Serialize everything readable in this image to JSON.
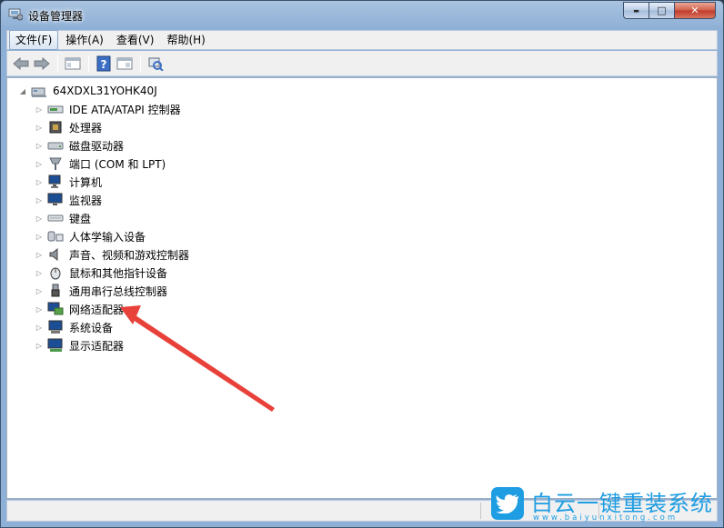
{
  "window": {
    "title": "设备管理器",
    "controls": {
      "minimize": "▬",
      "maximize": "□",
      "close": "✕"
    }
  },
  "menu": {
    "items": [
      {
        "label": "文件(F)"
      },
      {
        "label": "操作(A)"
      },
      {
        "label": "查看(V)"
      },
      {
        "label": "帮助(H)"
      }
    ]
  },
  "toolbar": {
    "buttons": [
      "back-icon",
      "forward-icon",
      "show-hide-console-tree-icon",
      "help-icon",
      "properties-icon",
      "scan-hardware-icon"
    ]
  },
  "tree": {
    "root": {
      "label": "64XDXL31YOHK40J",
      "icon": "computer-icon"
    },
    "items": [
      {
        "label": "IDE ATA/ATAPI 控制器",
        "icon": "ide-controller-icon"
      },
      {
        "label": "处理器",
        "icon": "processor-icon"
      },
      {
        "label": "磁盘驱动器",
        "icon": "disk-drive-icon"
      },
      {
        "label": "端口 (COM 和 LPT)",
        "icon": "port-icon"
      },
      {
        "label": "计算机",
        "icon": "computer-icon"
      },
      {
        "label": "监视器",
        "icon": "monitor-icon"
      },
      {
        "label": "键盘",
        "icon": "keyboard-icon"
      },
      {
        "label": "人体学输入设备",
        "icon": "hid-icon"
      },
      {
        "label": "声音、视频和游戏控制器",
        "icon": "speaker-icon"
      },
      {
        "label": "鼠标和其他指针设备",
        "icon": "mouse-icon"
      },
      {
        "label": "通用串行总线控制器",
        "icon": "usb-icon"
      },
      {
        "label": "网络适配器",
        "icon": "network-adapter-icon"
      },
      {
        "label": "系统设备",
        "icon": "system-device-icon"
      },
      {
        "label": "显示适配器",
        "icon": "display-adapter-icon"
      }
    ]
  },
  "annotation": {
    "color": "#e8413a",
    "points_to": "网络适配器"
  },
  "watermark": {
    "title": "白云一键重装系统",
    "url": "www.baiyunxitong.com",
    "color": "#1e9de3"
  }
}
